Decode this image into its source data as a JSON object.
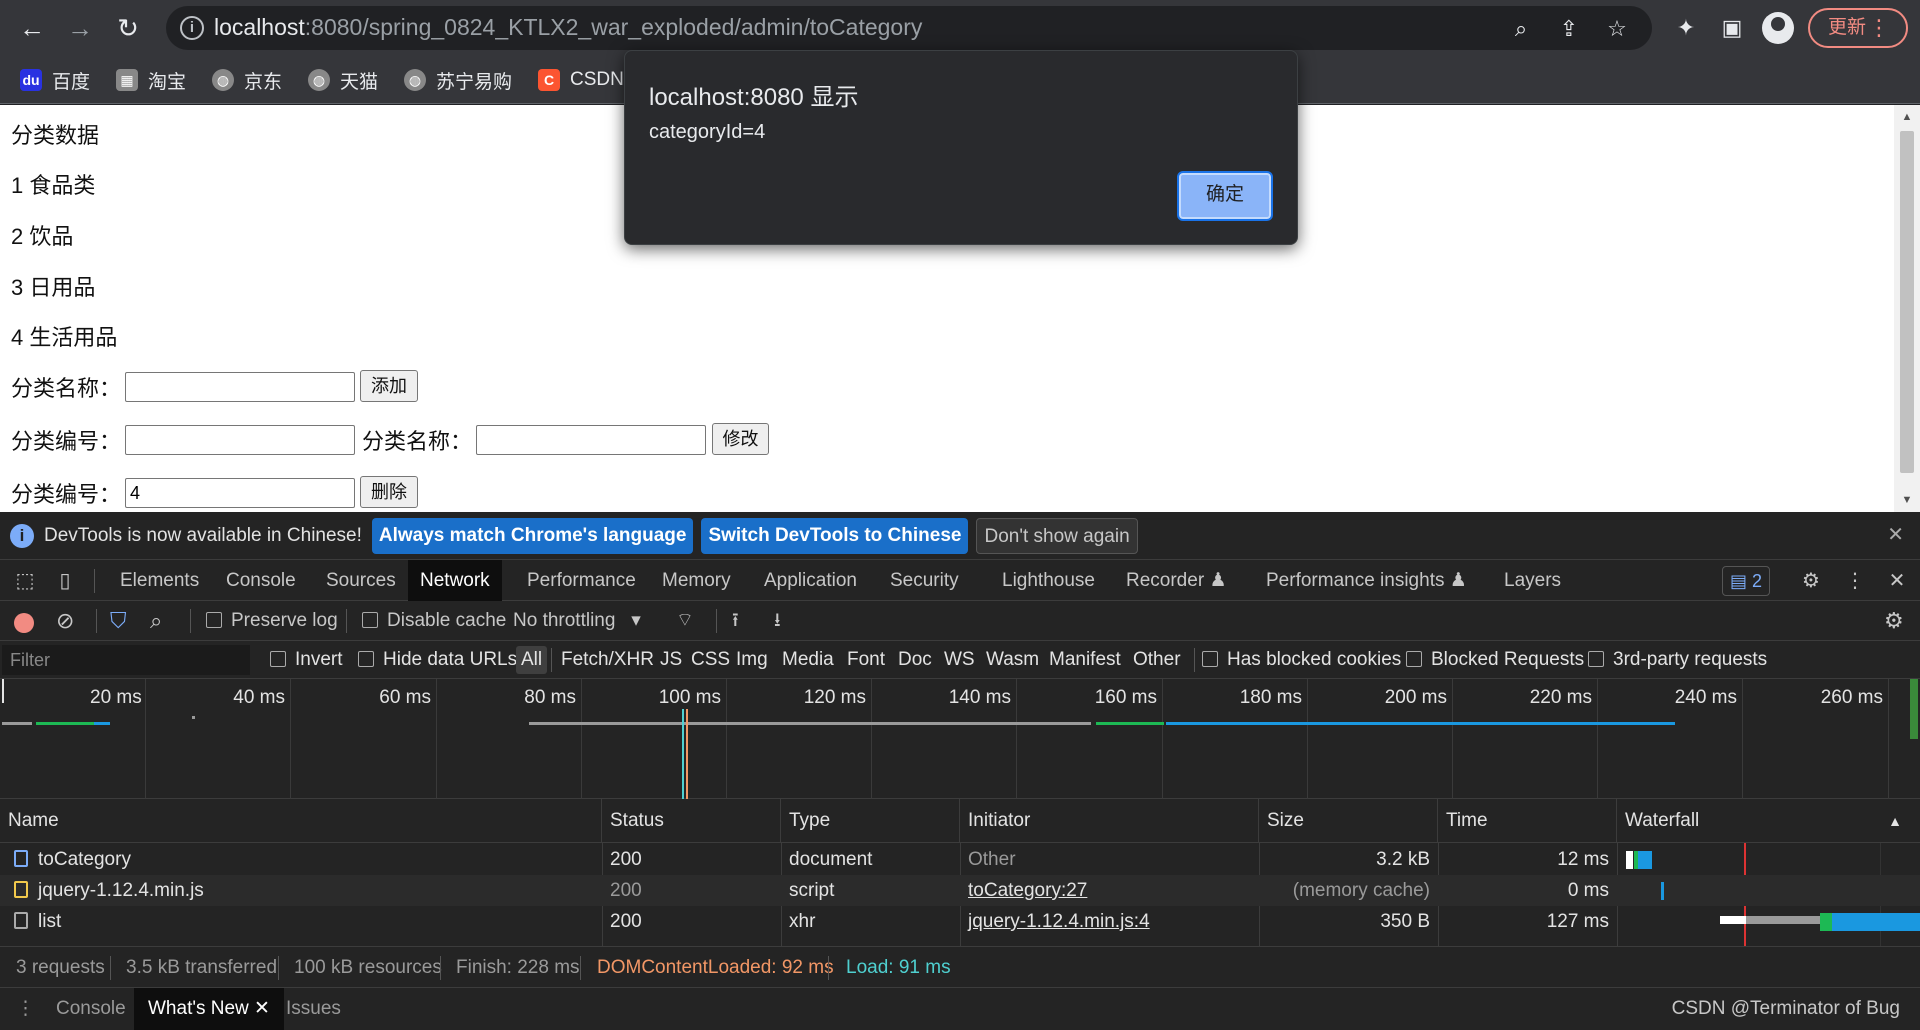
{
  "browser": {
    "url_host": "localhost",
    "url_rest": ":8080/spring_0824_KTLX2_war_exploded/admin/toCategory",
    "update_label": "更新",
    "bookmarks": [
      "百度",
      "淘宝",
      "京东",
      "天猫",
      "苏宁易购",
      "CSDN"
    ]
  },
  "page": {
    "heading": "分类数据",
    "categories": [
      "1 食品类",
      "2 饮品",
      "3 日用品",
      "4 生活用品"
    ],
    "add_row": {
      "label": "分类名称：",
      "value": "",
      "button": "添加"
    },
    "edit_row": {
      "id_label": "分类编号：",
      "id_value": "",
      "name_label": "分类名称：",
      "name_value": "",
      "button": "修改"
    },
    "delete_row": {
      "label": "分类编号：",
      "value": "4",
      "button": "删除"
    }
  },
  "dialog": {
    "title": "localhost:8080 显示",
    "message": "categoryId=4",
    "ok_label": "确定"
  },
  "infobar": {
    "text": "DevTools is now available in Chinese!",
    "btn_match": "Always match Chrome's language",
    "btn_switch": "Switch DevTools to Chinese",
    "btn_dismiss": "Don't show again"
  },
  "devtools": {
    "tabs": [
      "Elements",
      "Console",
      "Sources",
      "Network",
      "Performance",
      "Memory",
      "Application",
      "Security",
      "Lighthouse",
      "Recorder",
      "Performance insights",
      "Layers"
    ],
    "active_tab": "Network",
    "issues_count": "2",
    "toolbar": {
      "preserve_log": "Preserve log",
      "disable_cache": "Disable cache",
      "throttling": "No throttling"
    },
    "filter": {
      "placeholder": "Filter",
      "invert": "Invert",
      "hide_data_urls": "Hide data URLs",
      "types": [
        "All",
        "Fetch/XHR",
        "JS",
        "CSS",
        "Img",
        "Media",
        "Font",
        "Doc",
        "WS",
        "Wasm",
        "Manifest",
        "Other"
      ],
      "has_blocked_cookies": "Has blocked cookies",
      "blocked_requests": "Blocked Requests",
      "third_party": "3rd-party requests"
    },
    "timeline_ticks": [
      "20 ms",
      "40 ms",
      "60 ms",
      "80 ms",
      "100 ms",
      "120 ms",
      "140 ms",
      "160 ms",
      "180 ms",
      "200 ms",
      "220 ms",
      "240 ms",
      "260 ms"
    ],
    "columns": [
      "Name",
      "Status",
      "Type",
      "Initiator",
      "Size",
      "Time",
      "Waterfall"
    ],
    "requests": [
      {
        "name": "toCategory",
        "status": "200",
        "type": "document",
        "initiator": "Other",
        "size": "3.2 kB",
        "time": "12 ms"
      },
      {
        "name": "jquery-1.12.4.min.js",
        "status": "200",
        "type": "script",
        "initiator": "toCategory:27",
        "size": "(memory cache)",
        "time": "0 ms"
      },
      {
        "name": "list",
        "status": "200",
        "type": "xhr",
        "initiator": "jquery-1.12.4.min.js:4",
        "size": "350 B",
        "time": "127 ms"
      }
    ],
    "summary": {
      "requests": "3 requests",
      "transferred": "3.5 kB transferred",
      "resources": "100 kB resources",
      "finish": "Finish: 228 ms",
      "dcl": "DOMContentLoaded: 92 ms",
      "load": "Load: 91 ms"
    },
    "drawer_tabs": [
      "Console",
      "What's New",
      "Issues"
    ],
    "watermark": "CSDN @Terminator of Bug"
  },
  "colors": {
    "dcl": "#f29766",
    "load": "#4fd0d0",
    "accent": "#7cacf8"
  }
}
